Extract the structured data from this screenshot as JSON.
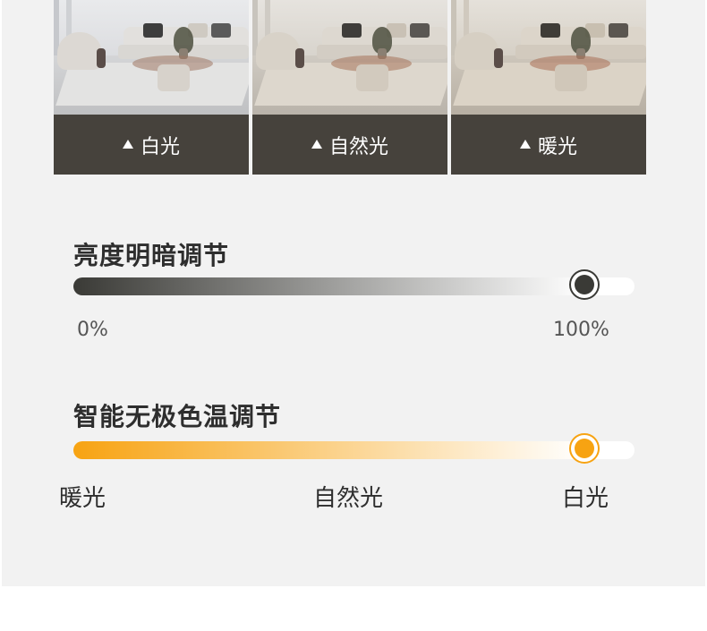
{
  "light_modes": [
    {
      "label": "白光",
      "icon": "triangle-up-icon"
    },
    {
      "label": "自然光",
      "icon": "triangle-up-icon"
    },
    {
      "label": "暖光",
      "icon": "triangle-up-icon"
    }
  ],
  "brightness": {
    "title": "亮度明暗调节",
    "min_label": "0%",
    "max_label": "100%",
    "value": 0.91,
    "track_colors": [
      "#3a3a36",
      "#ffffff"
    ],
    "knob_color": "#3a3a36"
  },
  "color_temperature": {
    "title": "智能无极色温调节",
    "labels": [
      "暖光",
      "自然光",
      "白光"
    ],
    "value": 0.91,
    "track_colors": [
      "#f7a312",
      "#ffffff"
    ],
    "knob_color": "#f7a312"
  },
  "colors": {
    "panel": "#f2f2f2",
    "caption_bg": "#46423c",
    "accent_orange": "#f7a312",
    "dark": "#3a3a36"
  }
}
